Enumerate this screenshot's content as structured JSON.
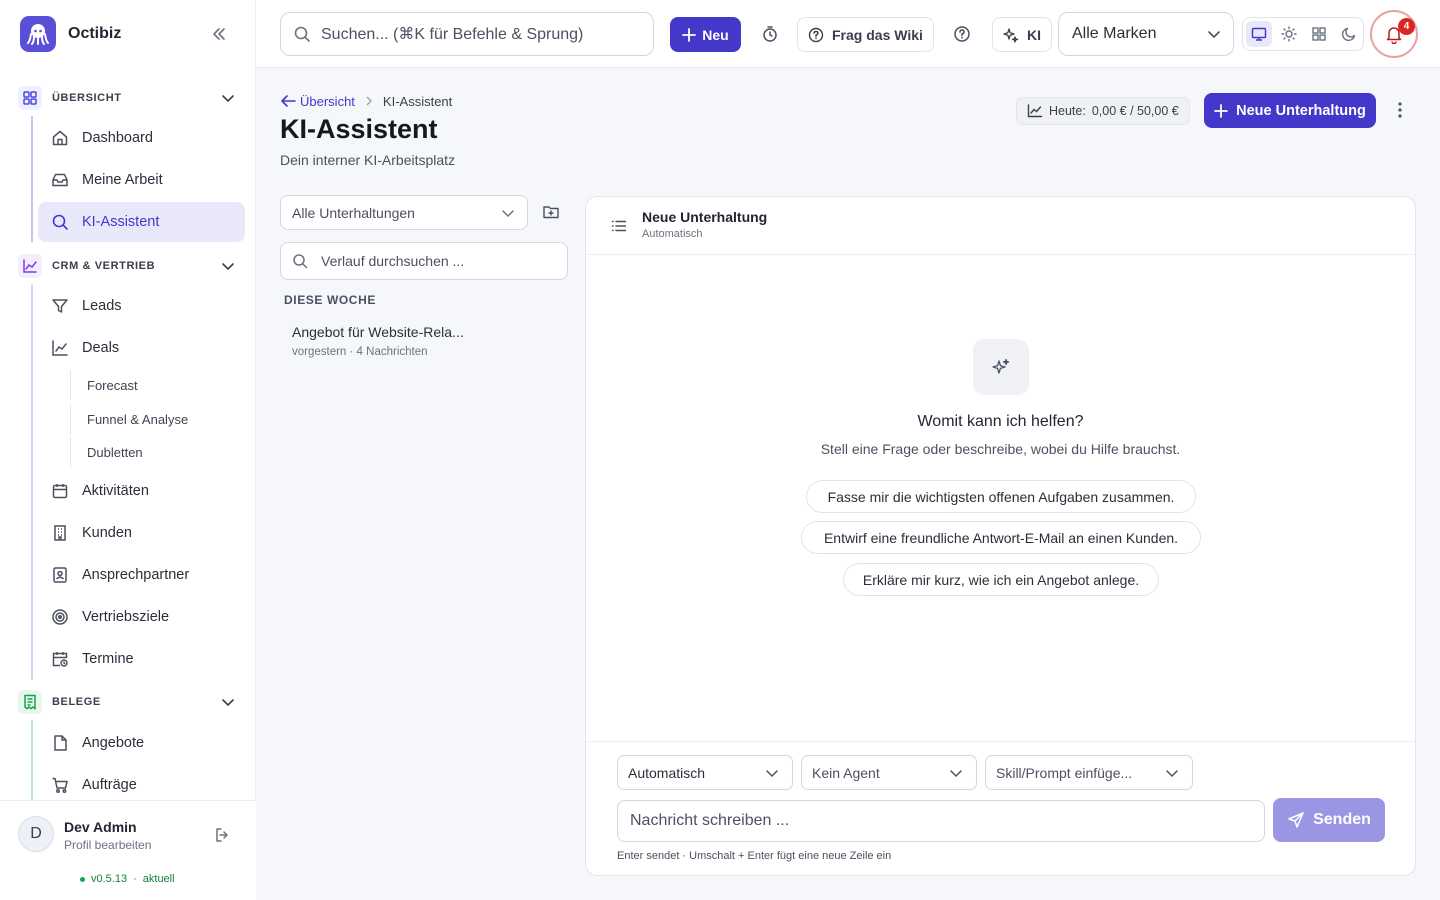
{
  "app": {
    "name": "Octibiz",
    "version": "v0.5.13",
    "version_status": "aktuell"
  },
  "colors": {
    "primary": "#4338ca",
    "primary_soft": "#e9e8fb",
    "send_disabled": "#9a96e4",
    "danger": "#dc2626"
  },
  "topbar": {
    "search_placeholder": "Suchen... (⌘K für Befehle & Sprung)",
    "new_label": "Neu",
    "wiki_label": "Frag das Wiki",
    "ai_label": "KI",
    "brand_select": "Alle Marken",
    "notifications_count": "4"
  },
  "sidebar": {
    "sections": [
      {
        "label": "ÜBERSICHT",
        "icon": "grid-icon",
        "items": [
          {
            "label": "Dashboard",
            "icon": "home-icon"
          },
          {
            "label": "Meine Arbeit",
            "icon": "inbox-icon"
          },
          {
            "label": "KI-Assistent",
            "icon": "chat-search-icon",
            "active": true
          }
        ]
      },
      {
        "label": "CRM & VERTRIEB",
        "icon": "chart-line-icon",
        "items": [
          {
            "label": "Leads",
            "icon": "filter-icon"
          },
          {
            "label": "Deals",
            "icon": "trend-icon"
          },
          {
            "label": "Aktivitäten",
            "icon": "calendar-icon"
          },
          {
            "label": "Kunden",
            "icon": "building-icon"
          },
          {
            "label": "Ansprechpartner",
            "icon": "contact-icon"
          },
          {
            "label": "Vertriebsziele",
            "icon": "target-icon"
          },
          {
            "label": "Termine",
            "icon": "calendar-clock-icon"
          }
        ],
        "subitems": [
          {
            "label": "Forecast"
          },
          {
            "label": "Funnel & Analyse"
          },
          {
            "label": "Dubletten"
          }
        ]
      },
      {
        "label": "BELEGE",
        "icon": "receipt-icon",
        "items": [
          {
            "label": "Angebote",
            "icon": "file-icon"
          },
          {
            "label": "Aufträge",
            "icon": "cart-icon"
          }
        ]
      }
    ],
    "user": {
      "initial": "D",
      "name": "Dev Admin",
      "sub": "Profil bearbeiten"
    }
  },
  "page": {
    "breadcrumb": {
      "back": "Übersicht",
      "current": "KI-Assistent"
    },
    "title": "KI-Assistent",
    "subtitle": "Dein interner KI-Arbeitsplatz",
    "cost": {
      "label": "Heute:",
      "value": "0,00 € / 50,00 €"
    },
    "new_conversation": "Neue Unterhaltung"
  },
  "history": {
    "filter": "Alle Unterhaltungen",
    "search_placeholder": "Verlauf durchsuchen ...",
    "groups": [
      {
        "label": "DIESE WOCHE",
        "items": [
          {
            "title": "Angebot für Website-Rela...",
            "meta": "vorgestern · 4 Nachrichten"
          }
        ]
      }
    ]
  },
  "chat": {
    "title": "Neue Unterhaltung",
    "mode": "Automatisch",
    "empty_title": "Womit kann ich helfen?",
    "empty_sub": "Stell eine Frage oder beschreibe, wobei du Hilfe brauchst.",
    "suggestions": [
      "Fasse mir die wichtigsten offenen Aufgaben zusammen.",
      "Entwirf eine freundliche Antwort-E-Mail an einen Kunden.",
      "Erkläre mir kurz, wie ich ein Angebot anlege."
    ],
    "composer": {
      "model_select": "Automatisch",
      "agent_select": "Kein Agent",
      "skill_select": "Skill/Prompt einfüge...",
      "input_placeholder": "Nachricht schreiben ...",
      "send_label": "Senden",
      "hint": "Enter sendet · Umschalt + Enter fügt eine neue Zeile ein"
    }
  }
}
